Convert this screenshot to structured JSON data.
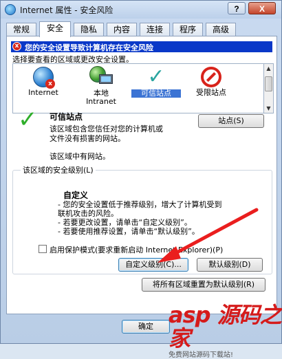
{
  "window": {
    "title": "Internet 属性 - 安全风险",
    "help_label": "?",
    "close_label": "X"
  },
  "tabs": [
    {
      "label": "常规"
    },
    {
      "label": "安全"
    },
    {
      "label": "隐私"
    },
    {
      "label": "内容"
    },
    {
      "label": "连接"
    },
    {
      "label": "程序"
    },
    {
      "label": "高级"
    }
  ],
  "active_tab": "安全",
  "warning": {
    "icon": "shield-x-icon",
    "text": "您的安全设置导致计算机存在安全风险"
  },
  "instruction": "选择要查看的区域或更改安全设置。",
  "zones": [
    {
      "label": "Internet",
      "icon": "globe-icon"
    },
    {
      "label": "本地",
      "label2": "Intranet",
      "icon": "intranet-icon"
    },
    {
      "label": "可信站点",
      "icon": "check-icon",
      "selected": true
    },
    {
      "label": "受限站点",
      "icon": "no-entry-icon"
    }
  ],
  "zone_info": {
    "title": "可信站点",
    "desc_lines": [
      "该区域包含您信任对您的计算机或",
      "文件没有损害的网站。"
    ],
    "sites_note": "该区域中有网站。",
    "sites_button": "站点(S)"
  },
  "security_level": {
    "legend": "该区域的安全级别(L)",
    "title": "自定义",
    "lines": [
      "- 您的安全设置低于推荐级别，增大了计算机受到",
      "  联机攻击的风险。",
      "- 若要更改设置，请单击“自定义级别”。",
      "- 若要使用推荐设置，请单击“默认级别”。"
    ],
    "protected_mode": "启用保护模式(要求重新启动 Internet Explorer)(P)",
    "custom_button": "自定义级别(C)...",
    "default_button": "默认级别(D)",
    "reset_all_button": "将所有区域重置为默认级别(R)"
  },
  "footer": {
    "ok_button": "确定"
  },
  "watermark": {
    "text": "asp 源码之家",
    "sub": "免费网站源码下载站!"
  }
}
